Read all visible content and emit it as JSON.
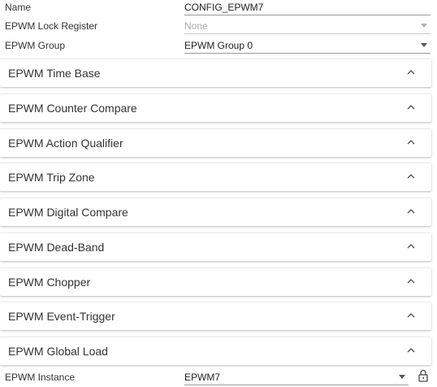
{
  "fields": {
    "name": {
      "label": "Name",
      "value": "CONFIG_EPWM7"
    },
    "lock_register": {
      "label": "EPWM Lock Register",
      "value": "None"
    },
    "group": {
      "label": "EPWM Group",
      "value": "EPWM Group 0"
    }
  },
  "sections": [
    {
      "title": "EPWM Time Base"
    },
    {
      "title": "EPWM Counter Compare"
    },
    {
      "title": "EPWM Action Qualifier"
    },
    {
      "title": "EPWM Trip Zone"
    },
    {
      "title": "EPWM Digital Compare"
    },
    {
      "title": "EPWM Dead-Band"
    },
    {
      "title": "EPWM Chopper"
    },
    {
      "title": "EPWM Event-Trigger"
    },
    {
      "title": "EPWM Global Load"
    }
  ],
  "instance": {
    "label": "EPWM Instance",
    "value": "EPWM7"
  },
  "icons": {
    "section_toggle": "chevron-up-icon",
    "dropdown": "chevron-down-icon",
    "lock": "lock-icon"
  }
}
